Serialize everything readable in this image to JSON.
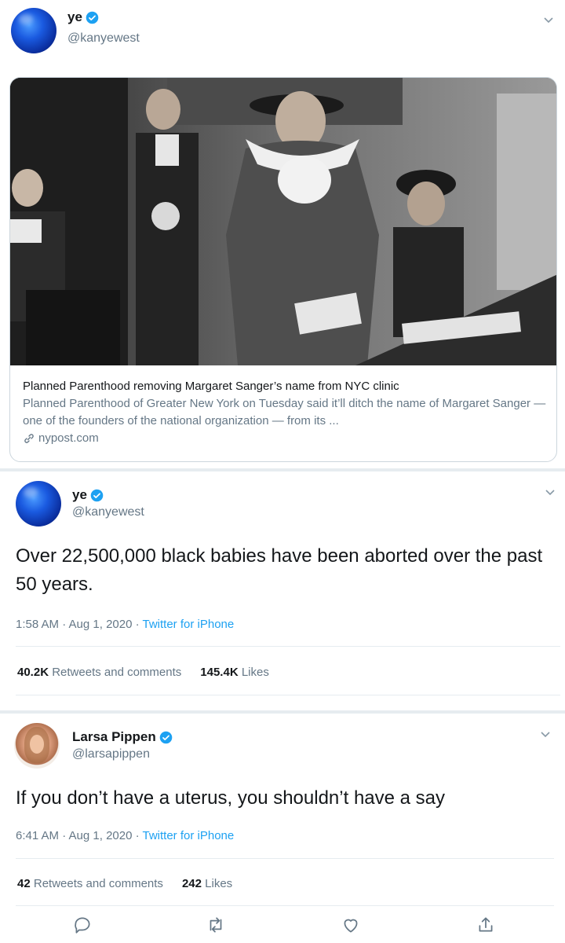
{
  "tweet1": {
    "display_name": "ye",
    "handle": "@kanyewest",
    "link_card": {
      "title": "Planned Parenthood removing Margaret Sanger’s name from NYC clinic",
      "description": "Planned Parenthood of Greater New York on Tuesday said it’ll ditch the name of Margaret Sanger — one of the founders of the national organization — from its ...",
      "domain": "nypost.com"
    }
  },
  "tweet2": {
    "display_name": "ye",
    "handle": "@kanyewest",
    "text": "Over 22,500,000 black babies have been aborted over the past 50 years.",
    "time": "1:58 AM · Aug 1, 2020 · ",
    "app": "Twitter for iPhone",
    "retweets_count": "40.2K",
    "retweets_label": "Retweets and comments",
    "likes_count": "145.4K",
    "likes_label": "Likes"
  },
  "tweet3": {
    "display_name": "Larsa Pippen",
    "handle": "@larsapippen",
    "text": "If you don’t have a uterus, you shouldn’t have a say",
    "time": "6:41 AM · Aug 1, 2020 · ",
    "app": "Twitter for iPhone",
    "retweets_count": "42",
    "retweets_label": "Retweets and comments",
    "likes_count": "242",
    "likes_label": "Likes"
  },
  "icons": [
    "verified-badge-icon",
    "chevron-down-icon",
    "link-icon",
    "reply-icon",
    "retweet-icon",
    "like-icon",
    "share-icon"
  ],
  "colors": {
    "accent": "#1da1f2",
    "text": "#14171a",
    "secondary": "#657786",
    "border": "#e6ecf0"
  }
}
